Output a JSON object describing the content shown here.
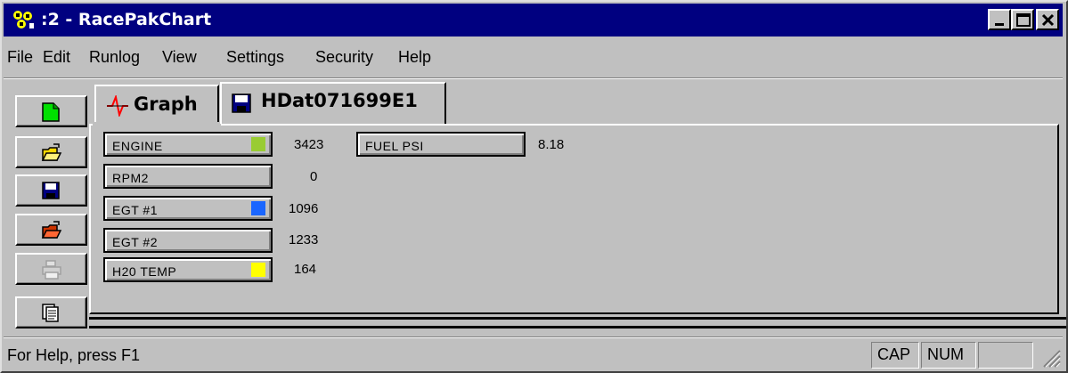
{
  "window": {
    "title": ":2 - RacePakChart",
    "minimize_icon": "minimize-icon",
    "restore_icon": "restore-icon",
    "close_icon": "close-icon"
  },
  "menu": {
    "items": [
      {
        "label": "File"
      },
      {
        "label": "Edit"
      },
      {
        "label": "Runlog"
      },
      {
        "label": "View"
      },
      {
        "label": "Settings"
      },
      {
        "label": "Security"
      },
      {
        "label": "Help"
      }
    ]
  },
  "toolbar": {
    "icons": [
      "new-document-icon",
      "open-folder-icon",
      "save-disk-icon",
      "import-folder-icon",
      "print-icon",
      "copy-pages-icon"
    ]
  },
  "tabs": [
    {
      "label": "Graph",
      "icon": "waveform-icon"
    },
    {
      "label": "HDat071699E1",
      "icon": "floppy-disk-icon",
      "active": true
    }
  ],
  "channels": [
    {
      "label": "ENGINE",
      "value": "3423",
      "swatch": "#99cc33"
    },
    {
      "label": "RPM2",
      "value": "0",
      "swatch": null
    },
    {
      "label": "EGT #1",
      "value": "1096",
      "swatch": "#1a66ff"
    },
    {
      "label": "EGT #2",
      "value": "1233",
      "swatch": null
    },
    {
      "label": "H20 TEMP",
      "value": "164",
      "swatch": "#ffff00"
    },
    {
      "label": "FUEL PSI",
      "value": "8.18",
      "swatch": null
    }
  ],
  "status": {
    "help_text": "For Help, press F1",
    "cap": "CAP",
    "num": "NUM",
    "scrl": ""
  },
  "colors": {
    "title_bar": "#000080",
    "face": "#c0c0c0"
  }
}
